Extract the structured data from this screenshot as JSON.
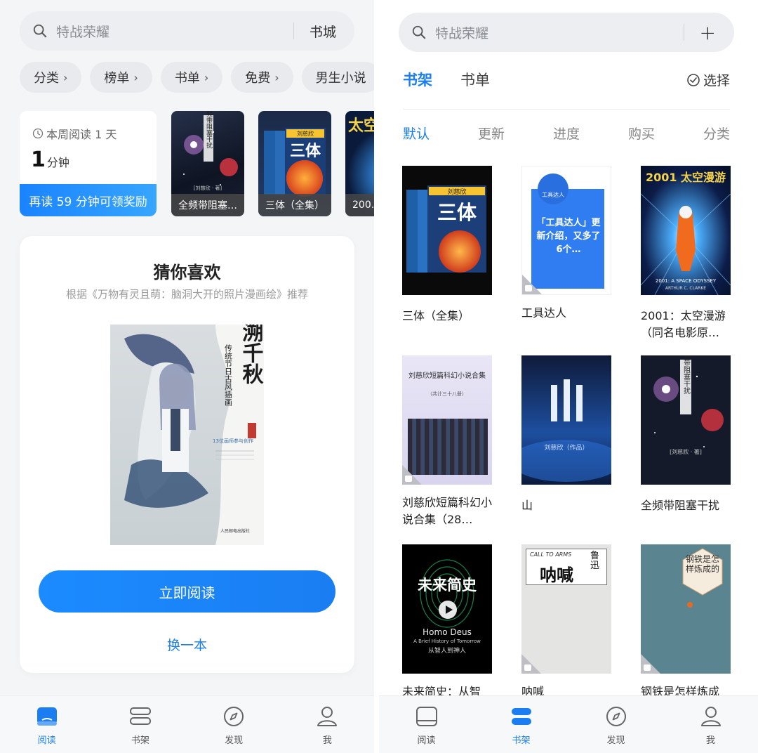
{
  "left": {
    "search": {
      "placeholder": "特战荣耀",
      "action": "书城"
    },
    "chips": [
      "分类",
      "榜单",
      "书单",
      "免费",
      "男生小说"
    ],
    "reading": {
      "week": "本周阅读 1 天",
      "minutes": "1",
      "unit": "分钟",
      "reward": "再读 59 分钟可领奖励"
    },
    "recent_books": [
      {
        "caption": "全频带阻塞…",
        "cover_text": "全频带阻塞干扰",
        "author": "[刘慈欣 · 著]"
      },
      {
        "caption": "三体（全集）",
        "cover_text": "三体",
        "author": "刘慈欣"
      },
      {
        "caption": "200…",
        "cover_text": "太空"
      }
    ],
    "recommend": {
      "title": "猜你喜欢",
      "subtitle": "根据《万物有灵且萌：脑洞大开的照片漫画绘》推荐",
      "cover": {
        "title": "溯千秋",
        "subtitle": "传统节日古风插画",
        "tagline": "13位画师参与创作",
        "publisher": "人民邮电出版社"
      },
      "read_button": "立即阅读",
      "swap_button": "换一本"
    },
    "tabbar": [
      {
        "label": "阅读",
        "icon": "book-open-icon",
        "active": true
      },
      {
        "label": "书架",
        "icon": "bookshelf-icon",
        "active": false
      },
      {
        "label": "发现",
        "icon": "compass-icon",
        "active": false
      },
      {
        "label": "我",
        "icon": "person-icon",
        "active": false
      }
    ]
  },
  "right": {
    "search": {
      "placeholder": "特战荣耀",
      "action": "+"
    },
    "header_tabs": [
      "书架",
      "书单"
    ],
    "select": "选择",
    "sort_tabs": [
      "默认",
      "更新",
      "进度",
      "购买",
      "分类"
    ],
    "books": [
      {
        "title": "三体（全集）",
        "cover_text": "三体",
        "cover_author": "刘慈欣"
      },
      {
        "title": "工具达人",
        "cover_text": "「工具达人」更新介绍，又多了6个…",
        "cover_badge": "工具达人"
      },
      {
        "title": "2001：太空漫游（同名电影原…",
        "cover_text": "2001 太空漫游",
        "cover_sub": "2001: A SPACE ODYSSEY",
        "cover_author": "ARTHUR C. CLARKE"
      },
      {
        "title": "刘慈欣短篇科幻小说合集（28…",
        "cover_text": "刘慈欣短篇科幻小说合集",
        "cover_sub": "（共计三十八册）"
      },
      {
        "title": "山",
        "cover_text": "山",
        "cover_author": "刘慈欣（作品）"
      },
      {
        "title": "全频带阻塞干扰",
        "cover_text": "全频带阻塞干扰",
        "cover_author": "[刘慈欣 · 著]"
      },
      {
        "title": "未来简史：从智",
        "cover_text": "未来简史",
        "cover_sub": "Homo Deus",
        "cover_sub2": "A Brief History of Tomorrow",
        "cover_tag": "从智人到神人"
      },
      {
        "title": "呐喊",
        "cover_text": "呐喊",
        "cover_author": "鲁迅",
        "cover_sub": "CALL TO ARMS"
      },
      {
        "title": "钢铁是怎样炼成",
        "cover_text": "钢铁是怎样炼成的"
      }
    ],
    "tabbar": [
      {
        "label": "阅读",
        "icon": "book-open-icon",
        "active": false
      },
      {
        "label": "书架",
        "icon": "bookshelf-icon",
        "active": true
      },
      {
        "label": "发现",
        "icon": "compass-icon",
        "active": false
      },
      {
        "label": "我",
        "icon": "person-icon",
        "active": false
      }
    ]
  },
  "colors": {
    "accent": "#1a7ef2",
    "card": "#ffffff",
    "page": "#f4f5f7"
  }
}
